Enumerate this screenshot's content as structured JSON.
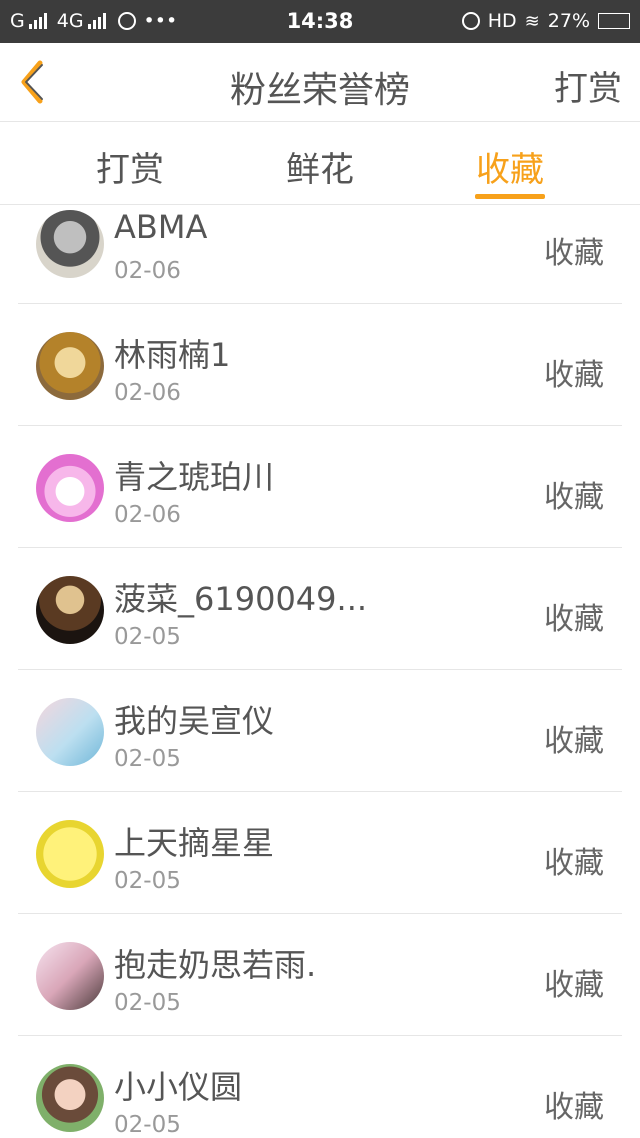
{
  "status_bar": {
    "left_text": "G",
    "network": "4G",
    "dots": "•••",
    "time": "14:38",
    "hd": "HD",
    "battery": "27%"
  },
  "navbar": {
    "title": "粉丝荣誉榜",
    "right_label": "打赏",
    "back_icon": "chevron-left-icon"
  },
  "tabs": [
    {
      "label": "打赏",
      "active": false
    },
    {
      "label": "鲜花",
      "active": false
    },
    {
      "label": "收藏",
      "active": true
    }
  ],
  "accent_color": "#f7a11b",
  "list": [
    {
      "name": "ABMA",
      "date": "02-06",
      "action": "收藏",
      "avatar": "portrait-photo"
    },
    {
      "name": "林雨楠1",
      "date": "02-06",
      "action": "收藏",
      "avatar": "cartoon-face"
    },
    {
      "name": "青之琥珀川",
      "date": "02-06",
      "action": "收藏",
      "avatar": "unicorn"
    },
    {
      "name": "菠菜_6190049...",
      "date": "02-05",
      "action": "收藏",
      "avatar": "coffee-cup"
    },
    {
      "name": "我的吴宣仪",
      "date": "02-05",
      "action": "收藏",
      "avatar": "couple-photo"
    },
    {
      "name": "上天摘星星",
      "date": "02-05",
      "action": "收藏",
      "avatar": "sponge-cartoon"
    },
    {
      "name": "抱走奶思若雨.",
      "date": "02-05",
      "action": "收藏",
      "avatar": "girl-photo"
    },
    {
      "name": "小小仪圆",
      "date": "02-05",
      "action": "收藏",
      "avatar": "girl-cap-photo"
    }
  ]
}
